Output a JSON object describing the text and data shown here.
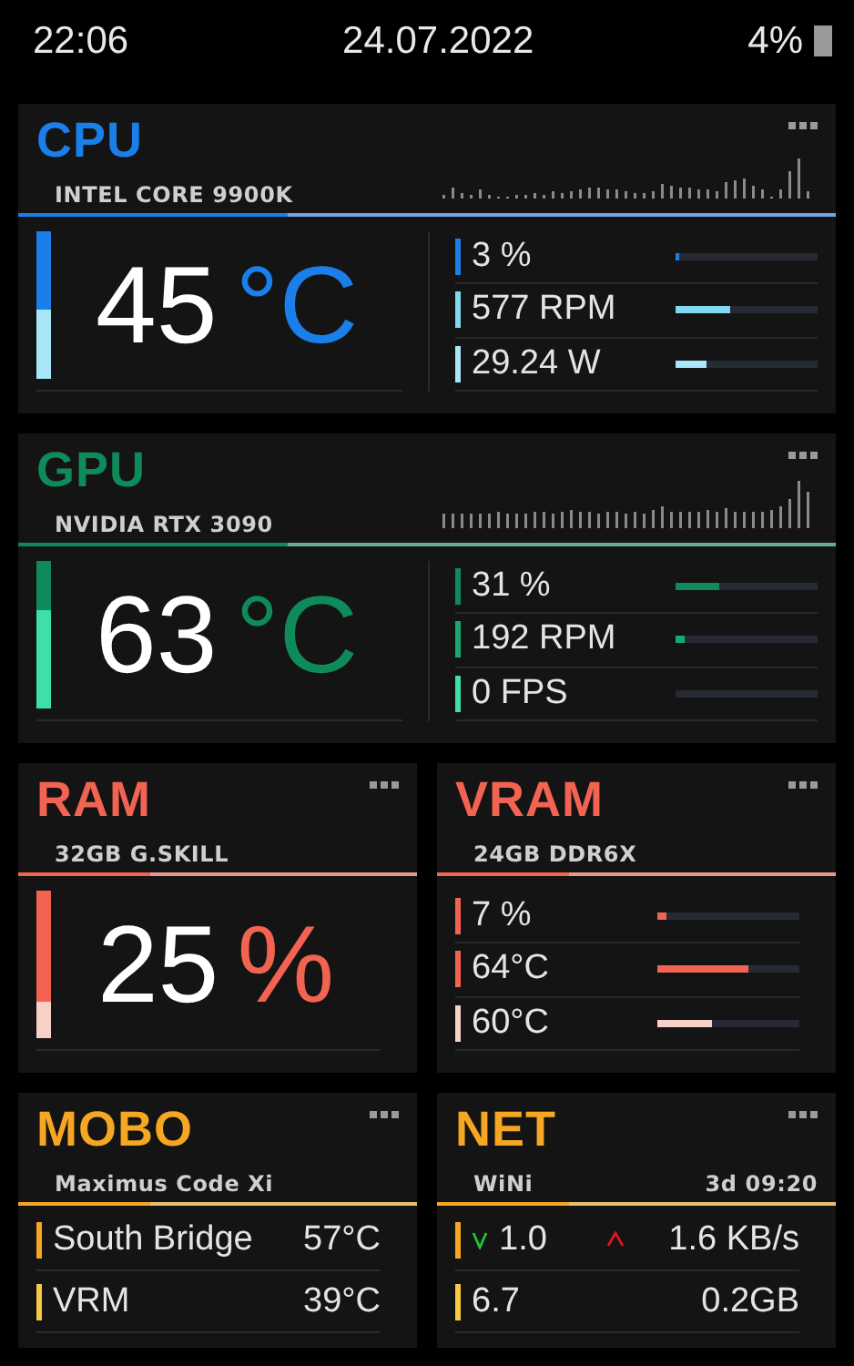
{
  "status_bar": {
    "time": "22:06",
    "date": "24.07.2022",
    "battery": "4%"
  },
  "cards": [
    {
      "kind": "big",
      "title": "CPU",
      "subtitle": "INTEL CORE 9900K",
      "color": "#1a7fe8",
      "gauge": {
        "value": "45",
        "unit": "°C",
        "level": 0.47,
        "color": "#a8e6f8"
      },
      "metrics": [
        {
          "reading": "3 %",
          "level": 0.03,
          "color": "#1a7fe8"
        },
        {
          "reading": "577 RPM",
          "level": 0.38,
          "color": "#7fd8f0"
        },
        {
          "reading": "29.24 W",
          "level": 0.22,
          "color": "#a8e6f8"
        }
      ]
    },
    {
      "kind": "big",
      "title": "GPU",
      "subtitle": "NVIDIA RTX 3090",
      "color": "#0f8a5a",
      "gauge": {
        "value": "63",
        "unit": "°C",
        "level": 0.67,
        "color": "#3de0a8"
      },
      "metrics": [
        {
          "reading": "31 %",
          "level": 0.31,
          "color": "#0f8a5a"
        },
        {
          "reading": "192 RPM",
          "level": 0.06,
          "color": "#1aa870"
        },
        {
          "reading": "0 FPS",
          "level": 0,
          "color": "#3de0a8"
        }
      ]
    },
    {
      "kind": "gauge",
      "title": "RAM",
      "subtitle": "32GB G.SKILL",
      "color": "#f26451",
      "gauge": {
        "value": "25",
        "unit": "%",
        "level": 0.25,
        "color": "#f9d0c8"
      }
    },
    {
      "kind": "metrics",
      "title": "VRAM",
      "subtitle": "24GB DDR6X",
      "color": "#f26451",
      "metrics": [
        {
          "reading": "7 %",
          "level": 0.07,
          "color": "#f26451"
        },
        {
          "reading": "64°C",
          "level": 0.64,
          "color": "#f26451"
        },
        {
          "reading": "60°C",
          "level": 0.39,
          "color": "#f9d0c8"
        }
      ]
    },
    {
      "kind": "sensors",
      "title": "MOBO",
      "subtitle": "Maximus Code Xi",
      "color": "#f5a623",
      "rows": [
        {
          "label": "South Bridge",
          "value": "57°C",
          "color": "#f5a623"
        },
        {
          "label": "VRM",
          "value": "39°C",
          "color": "#f7c945"
        }
      ]
    },
    {
      "kind": "net",
      "title": "NET",
      "subtitle": "WiNi",
      "uptime": "3d 09:20",
      "color": "#f5a623",
      "rows": [
        {
          "color": "#f5a623",
          "left": {
            "kind": "down",
            "value": "1.0"
          },
          "right": {
            "kind": "up",
            "value": "1.6 KB/s"
          }
        },
        {
          "color": "#f7c945",
          "left": {
            "value": "6.7"
          },
          "right": {
            "value": "0.2GB"
          }
        }
      ]
    }
  ]
}
